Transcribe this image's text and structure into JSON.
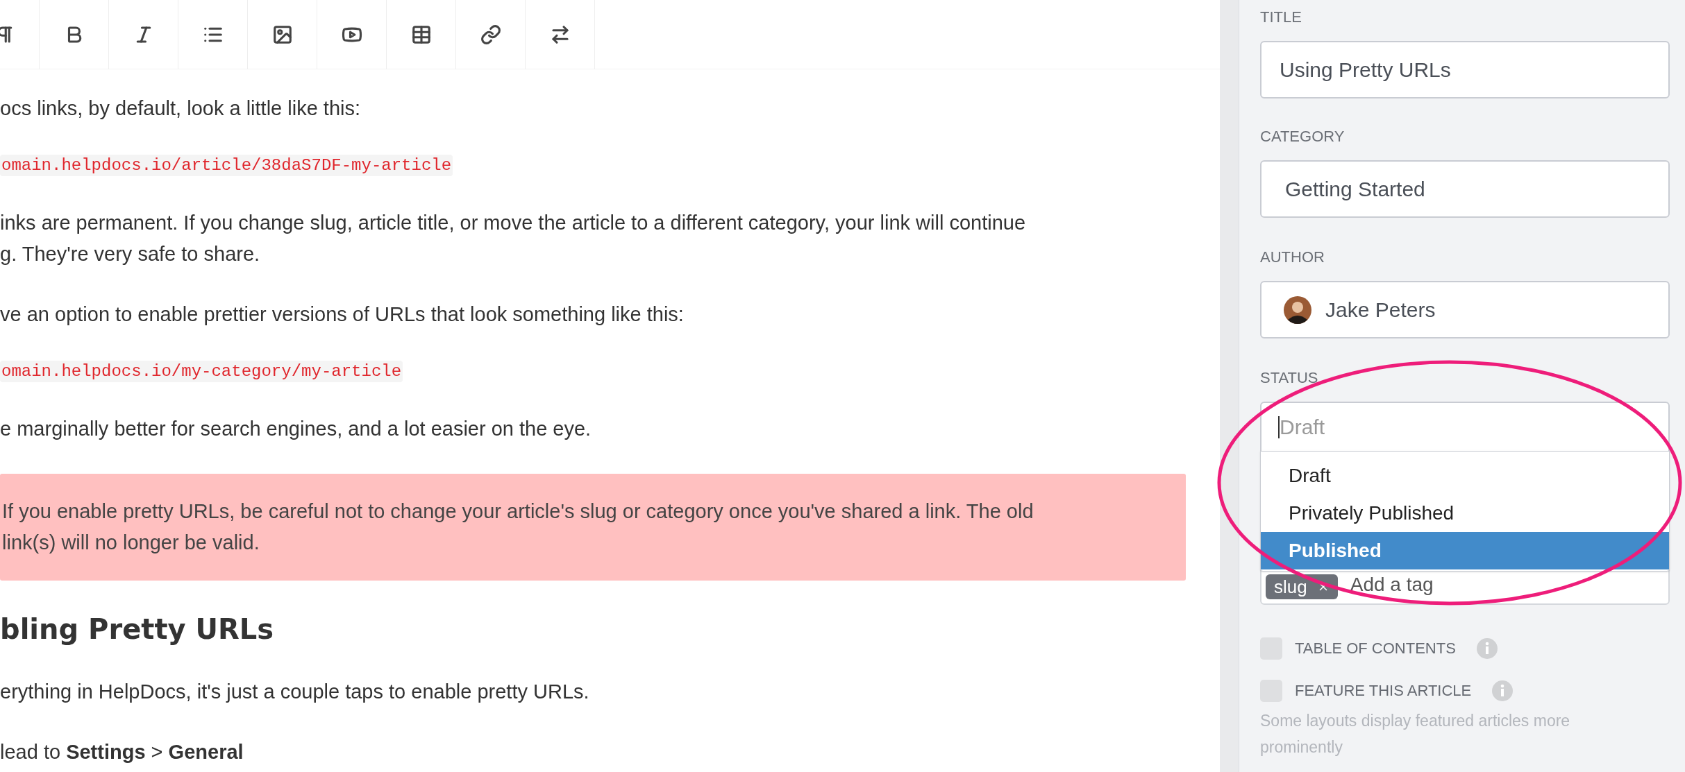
{
  "editor": {
    "blocks": [
      {
        "kind": "paragraph",
        "text": "ocs links, by default, look a little like this:"
      },
      {
        "kind": "code",
        "text": "omain.helpdocs.io/article/38daS7DF-my-article"
      },
      {
        "kind": "paragraph",
        "text": "inks are permanent. If you change slug, article title, or move the article to a different category, your link will continue\ng. They're very safe to share."
      },
      {
        "kind": "paragraph",
        "text": "ve an option to enable prettier versions of URLs that look something like this:"
      },
      {
        "kind": "code",
        "text": "omain.helpdocs.io/my-category/my-article"
      },
      {
        "kind": "paragraph",
        "text": "e marginally better for search engines, and a lot easier on the eye."
      },
      {
        "kind": "alert",
        "text": "If you enable pretty URLs, be careful not to change your article's slug or category once you've shared a link. The old\nlink(s) will no longer be valid."
      },
      {
        "kind": "heading",
        "text": "bling Pretty URLs"
      },
      {
        "kind": "paragraph",
        "text": "erything in HelpDocs, it's just a couple taps to enable pretty URLs."
      },
      {
        "kind": "paragraph",
        "text": "lead to **Settings** > **General**"
      }
    ]
  },
  "sidebar": {
    "title": {
      "label": "TITLE",
      "value": "Using Pretty URLs"
    },
    "category": {
      "label": "CATEGORY",
      "value": "Getting Started"
    },
    "author": {
      "label": "AUTHOR",
      "value": "Jake Peters"
    },
    "status": {
      "label": "STATUS",
      "placeholder": "Draft",
      "options": [
        {
          "label": "Draft",
          "selected": false
        },
        {
          "label": "Privately Published",
          "selected": false
        },
        {
          "label": "Published",
          "selected": true
        }
      ]
    },
    "tags": {
      "items": [
        "slug"
      ],
      "placeholder": "Add a tag"
    },
    "options": [
      {
        "label": "TABLE OF CONTENTS",
        "checked": false
      },
      {
        "label": "FEATURE THIS ARTICLE",
        "checked": false,
        "help": "Some layouts display featured articles more prominently"
      }
    ]
  }
}
